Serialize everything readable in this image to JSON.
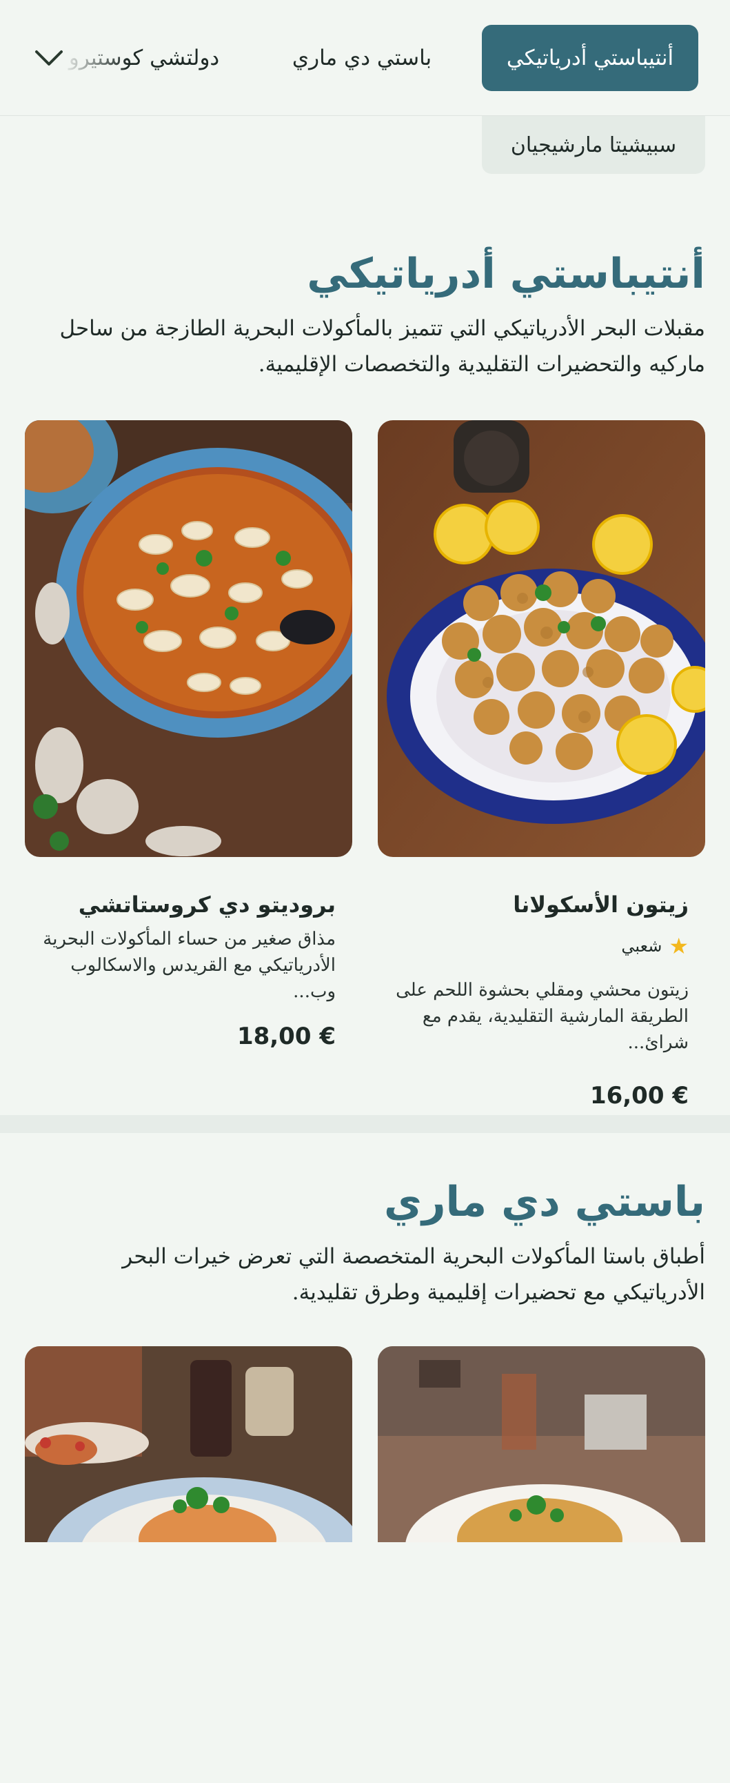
{
  "nav": {
    "tabs": [
      {
        "label": "أنتيباستي أدرياتيكي",
        "active": true
      },
      {
        "label": "باستي دي ماري",
        "active": false
      },
      {
        "label": "دولتشي كوستيرو",
        "active": false
      }
    ],
    "subtab": "سبيشيتا مارشيجيان",
    "expand_icon": "chevron-down-icon"
  },
  "sections": [
    {
      "title": "أنتيباستي أدرياتيكي",
      "description": "مقبلات البحر الأدرياتيكي التي تتميز بالمأكولات البحرية الطازجة من ساحل ماركيه والتحضيرات التقليدية والتخصصات الإقليمية.",
      "items": [
        {
          "name": "زيتون الأسكولانا",
          "badge": "شعبي",
          "badge_icon": "star-icon",
          "description": "زيتون محشي ومقلي بحشوة اللحم على الطريقة المارشية التقليدية، يقدم مع شرائ...",
          "price": "16,00 €"
        },
        {
          "name": "بروديتو دي كروستاتشي",
          "description": "مذاق صغير من حساء المأكولات البحرية الأدرياتيكي مع القريدس والاسكالوب وب...",
          "price": "18,00 €"
        }
      ]
    },
    {
      "title": "باستي دي ماري",
      "description": "أطباق باستا المأكولات البحرية المتخصصة التي تعرض خيرات البحر الأدرياتيكي مع تحضيرات إقليمية وطرق تقليدية."
    }
  ],
  "colors": {
    "accent": "#356b7a",
    "background": "#f2f6f2",
    "star": "#f3b81e"
  }
}
